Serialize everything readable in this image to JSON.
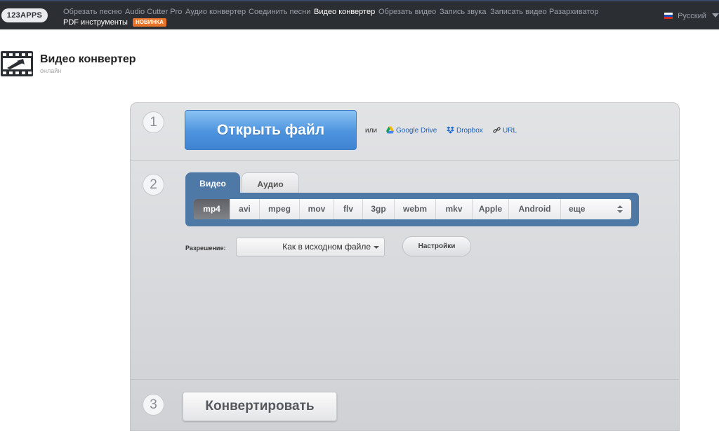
{
  "nav": {
    "logo": "123APPS",
    "links": [
      "Обрезать песню",
      "Audio Cutter Pro",
      "Аудио конвертер",
      "Соединить песни",
      "Видео конвертер",
      "Обрезать видео",
      "Запись звука",
      "Записать видео",
      "Разархиватор"
    ],
    "active_link": "Видео конвертер",
    "pdf_link": "PDF инструменты",
    "pdf_badge": "НОВИНКА",
    "badge_color": "#e8742a",
    "language": "Русский"
  },
  "app": {
    "title": "Видео конвертер",
    "subtitle": "онлайн",
    "icon": "video-film-icon"
  },
  "step1": {
    "number": "1",
    "open_button": "Открыть файл",
    "or_text": "или",
    "sources": [
      {
        "label": "Google Drive",
        "icon": "google-drive-icon"
      },
      {
        "label": "Dropbox",
        "icon": "dropbox-icon"
      },
      {
        "label": "URL",
        "icon": "link-icon"
      }
    ]
  },
  "step2": {
    "number": "2",
    "tabs": [
      "Видео",
      "Аудио"
    ],
    "active_tab": "Видео",
    "formats": [
      "mp4",
      "avi",
      "mpeg",
      "mov",
      "flv",
      "3gp",
      "webm",
      "mkv",
      "Apple",
      "Android",
      "еще"
    ],
    "selected_format": "mp4",
    "resolution_label": "Разрешение:",
    "resolution_value": "Как в исходном файле",
    "settings_button": "Настройки"
  },
  "step3": {
    "number": "3",
    "convert_button": "Конвертировать"
  },
  "colors": {
    "accent_blue": "#4e78a6",
    "button_blue": "#4d93de",
    "topbar": "#2b2e33"
  }
}
